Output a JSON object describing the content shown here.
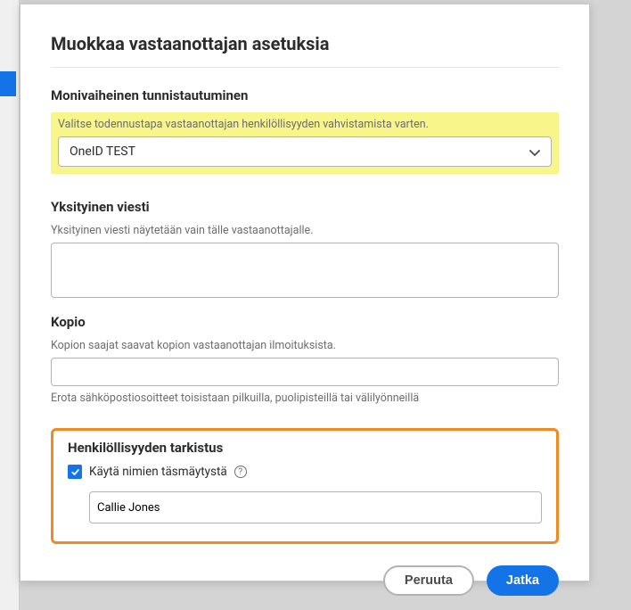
{
  "modal": {
    "title": "Muokkaa vastaanottajan asetuksia",
    "mfa": {
      "section_title": "Monivaiheinen tunnistautuminen",
      "helper": "Valitse todennustapa vastaanottajan henkilöllisyyden vahvistamista varten.",
      "selected": "OneID TEST"
    },
    "private_message": {
      "section_title": "Yksityinen viesti",
      "helper": "Yksityinen viesti näytetään vain tälle vastaanottajalle.",
      "value": ""
    },
    "copy": {
      "section_title": "Kopio",
      "helper": "Kopion saajat saavat kopion vastaanottajan ilmoituksista.",
      "value": "",
      "hint": "Erota sähköpostiosoitteet toisistaan pilkuilla, puolipisteillä tai välilyönneillä"
    },
    "identity": {
      "section_title": "Henkilöllisyyden tarkistus",
      "checkbox_label": "Käytä nimien täsmäytystä",
      "checked": true,
      "name_value": "Callie Jones"
    },
    "buttons": {
      "cancel": "Peruuta",
      "continue": "Jatka"
    }
  }
}
